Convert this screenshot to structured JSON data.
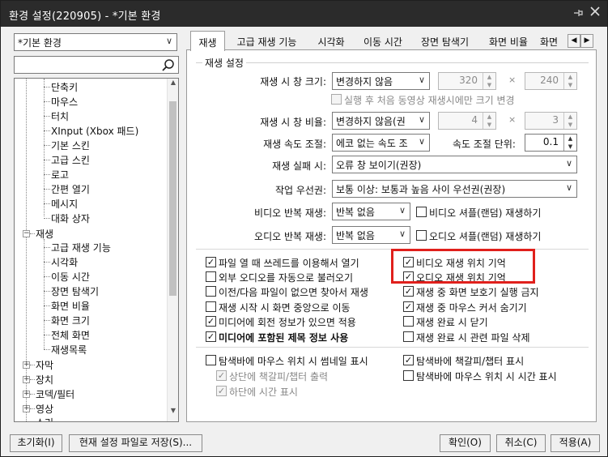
{
  "window": {
    "title": "환경 설정(220905) - *기본 환경"
  },
  "profile_select": {
    "value": "*기본 환경"
  },
  "search": {
    "placeholder": ""
  },
  "tree": {
    "items": [
      "단축키",
      "마우스",
      "터치",
      "XInput (Xbox 패드)",
      "기본 스킨",
      "고급 스킨",
      "로고",
      "간편 열기",
      "메시지",
      "대화 상자"
    ],
    "playback": "재생",
    "playback_children": [
      "고급 재생 기능",
      "시각화",
      "이동 시간",
      "장면 탐색기",
      "화면 비율",
      "화면 크기",
      "전체 화면",
      "재생목록"
    ],
    "collapsed": [
      "자막",
      "장치",
      "코덱/필터",
      "영상"
    ],
    "cut": "소리"
  },
  "tabs": [
    "재생",
    "고급 재생 기능",
    "시각화",
    "이동 시간",
    "장면 탐색기",
    "화면 비율",
    "화면"
  ],
  "group": {
    "title": "재생 설정"
  },
  "fields": {
    "window_size_label": "재생 시 창 크기:",
    "window_size_value": "변경하지 않음",
    "width_value": "320",
    "height_value": "240",
    "x_sep": "×",
    "first_only_label": "실행 후 처음 동영상 재생시에만 크기 변경",
    "ratio_label": "재생 시 창 비율:",
    "ratio_value": "변경하지 않음(권",
    "ratio_w": "4",
    "ratio_h": "3",
    "speed_label": "재생 속도 조절:",
    "speed_value": "에코 없는 속도 조",
    "speed_unit_label": "속도 조절 단위:",
    "speed_unit_value": "0.1",
    "fail_label": "재생 실패 시:",
    "fail_value": "오류 창 보이기(권장)",
    "priority_label": "작업 우선권:",
    "priority_value": "보통 이상: 보통과 높음 사이 우선권(권장)",
    "video_repeat_label": "비디오 반복 재생:",
    "video_repeat_value": "반복 없음",
    "video_shuffle_label": "비디오 셔플(랜덤) 재생하기",
    "audio_repeat_label": "오디오 반복 재생:",
    "audio_repeat_value": "반복 없음",
    "audio_shuffle_label": "오디오 셔플(랜덤) 재생하기"
  },
  "checks_left": [
    {
      "label": "파일 열 때 쓰레드를 이용해서 열기",
      "checked": true
    },
    {
      "label": "외부 오디오를 자동으로 불러오기",
      "checked": false
    },
    {
      "label": "이전/다음 파일이 없으면 찾아서 재생",
      "checked": false
    },
    {
      "label": "재생 시작 시 화면 중앙으로 이동",
      "checked": false
    },
    {
      "label": "미디어에 회전 정보가 있으면 적용",
      "checked": true
    },
    {
      "label": "미디어에 포함된 제목 정보 사용",
      "checked": true,
      "bold": true
    }
  ],
  "checks_right": [
    {
      "label": "비디오 재생 위치 기억",
      "checked": true
    },
    {
      "label": "오디오 재생 위치 기억",
      "checked": true
    },
    {
      "label": "재생 중 화면 보호기 실행 금지",
      "checked": true
    },
    {
      "label": "재생 중 마우스 커서 숨기기",
      "checked": true
    },
    {
      "label": "재생 완료 시 닫기",
      "checked": false
    },
    {
      "label": "재생 완료 시 관련 파일 삭제",
      "checked": false
    }
  ],
  "bottom_checks": {
    "thumb": {
      "label": "탐색바에 마우스 위치 시 썸네일 표시",
      "checked": false
    },
    "chapter_top": {
      "label": "상단에 책갈피/챕터 출력",
      "checked": true
    },
    "time_bottom": {
      "label": "하단에 시간 표시",
      "checked": true
    },
    "bookmark": {
      "label": "탐색바에 책갈피/챕터 표시",
      "checked": true
    },
    "time_pos": {
      "label": "탐색바에 마우스 위치 시 시간 표시",
      "checked": false
    }
  },
  "buttons": {
    "reset": "초기화(I)",
    "save_as": "현재 설정 파일로 저장(S)...",
    "ok": "확인(O)",
    "cancel": "취소(C)",
    "apply": "적용(A)"
  },
  "highlight_color": "#e0201c"
}
